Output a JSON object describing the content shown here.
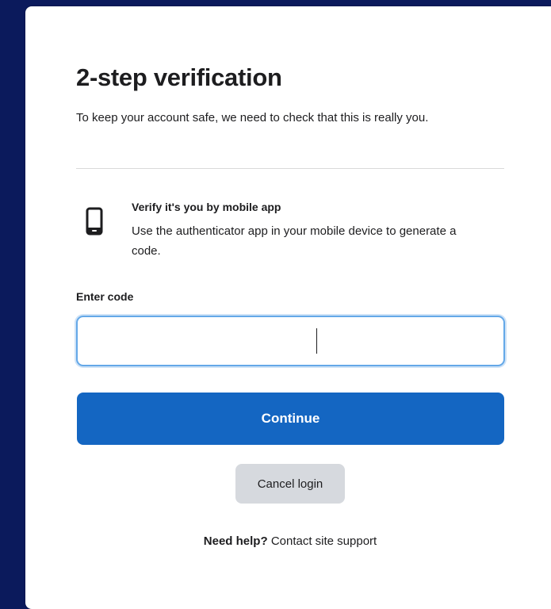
{
  "header": {
    "title": "2-step verification",
    "subtitle": "To keep your account safe, we need to check that this is really you."
  },
  "method": {
    "icon": "mobile-phone-icon",
    "title": "Verify it's you by mobile app",
    "description": "Use the authenticator app in your mobile device to generate a code."
  },
  "code_field": {
    "label": "Enter code",
    "value": "",
    "placeholder": ""
  },
  "actions": {
    "continue_label": "Continue",
    "cancel_label": "Cancel login"
  },
  "help": {
    "prefix": "Need help?",
    "link_label": "Contact site support"
  },
  "colors": {
    "page_background": "#0b1a5c",
    "primary": "#1466c2",
    "secondary_button": "#d6d9de",
    "focus_border": "#64a8e8"
  }
}
